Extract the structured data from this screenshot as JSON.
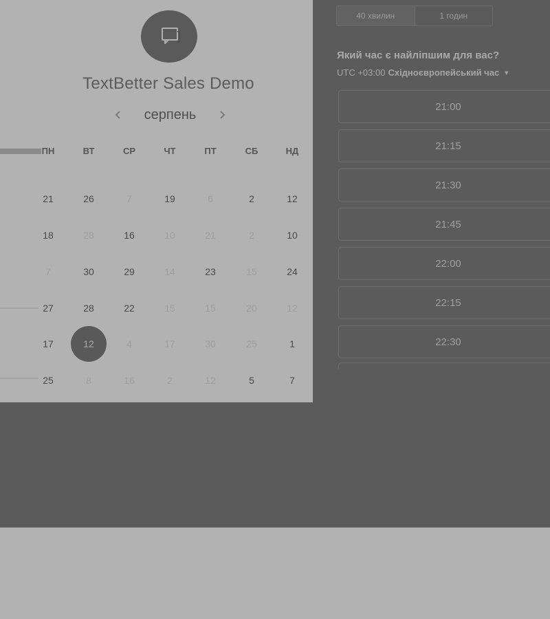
{
  "scheduler": {
    "title": "TextBetter Sales Demo",
    "logo_icon": "chat-bubble-icon",
    "month": "серпень",
    "prev_icon": "chevron-left-icon",
    "next_icon": "chevron-right-icon",
    "weekdays": [
      "ПН",
      "ВТ",
      "СР",
      "ЧТ",
      "ПТ",
      "СБ",
      "НД"
    ],
    "weeks": [
      [
        {
          "d": "21",
          "s": "active"
        },
        {
          "d": "26",
          "s": "active"
        },
        {
          "d": "7",
          "s": "disabled"
        },
        {
          "d": "19",
          "s": "active"
        },
        {
          "d": "6",
          "s": "disabled"
        },
        {
          "d": "2",
          "s": "active"
        },
        {
          "d": "12",
          "s": "active"
        }
      ],
      [
        {
          "d": "18",
          "s": "active"
        },
        {
          "d": "28",
          "s": "disabled"
        },
        {
          "d": "16",
          "s": "active"
        },
        {
          "d": "10",
          "s": "disabled"
        },
        {
          "d": "21",
          "s": "disabled"
        },
        {
          "d": "2",
          "s": "disabled"
        },
        {
          "d": "10",
          "s": "active"
        }
      ],
      [
        {
          "d": "7",
          "s": "disabled"
        },
        {
          "d": "30",
          "s": "active"
        },
        {
          "d": "29",
          "s": "active"
        },
        {
          "d": "14",
          "s": "disabled"
        },
        {
          "d": "23",
          "s": "active"
        },
        {
          "d": "15",
          "s": "disabled"
        },
        {
          "d": "24",
          "s": "active"
        }
      ],
      [
        {
          "d": "27",
          "s": "active"
        },
        {
          "d": "28",
          "s": "active"
        },
        {
          "d": "22",
          "s": "active"
        },
        {
          "d": "15",
          "s": "disabled"
        },
        {
          "d": "15",
          "s": "disabled"
        },
        {
          "d": "20",
          "s": "disabled"
        },
        {
          "d": "12",
          "s": "disabled"
        }
      ],
      [
        {
          "d": "17",
          "s": "active"
        },
        {
          "d": "12",
          "s": "selected"
        },
        {
          "d": "4",
          "s": "disabled"
        },
        {
          "d": "17",
          "s": "disabled"
        },
        {
          "d": "30",
          "s": "disabled"
        },
        {
          "d": "25",
          "s": "disabled"
        },
        {
          "d": "1",
          "s": "active"
        }
      ],
      [
        {
          "d": "25",
          "s": "active"
        },
        {
          "d": "8",
          "s": "disabled"
        },
        {
          "d": "16",
          "s": "disabled"
        },
        {
          "d": "2",
          "s": "disabled"
        },
        {
          "d": "12",
          "s": "disabled"
        },
        {
          "d": "5",
          "s": "active"
        },
        {
          "d": "7",
          "s": "active"
        }
      ]
    ]
  },
  "booking": {
    "durations": [
      "40 хвилин",
      "1 годин"
    ],
    "active_duration": "40 хвилин",
    "question": "Який час є найліпшим для вас?",
    "tz_prefix": "UTC +03:00",
    "tz_name": "Східноєвропейський час",
    "tz_caret_icon": "caret-down-icon",
    "slots": [
      "21:00",
      "21:15",
      "21:30",
      "21:45",
      "22:00",
      "22:15",
      "22:30"
    ]
  },
  "colors": {
    "panel_light": "#b2b2b2",
    "panel_dark": "#5b5b5b",
    "selected_day": "#595959"
  }
}
